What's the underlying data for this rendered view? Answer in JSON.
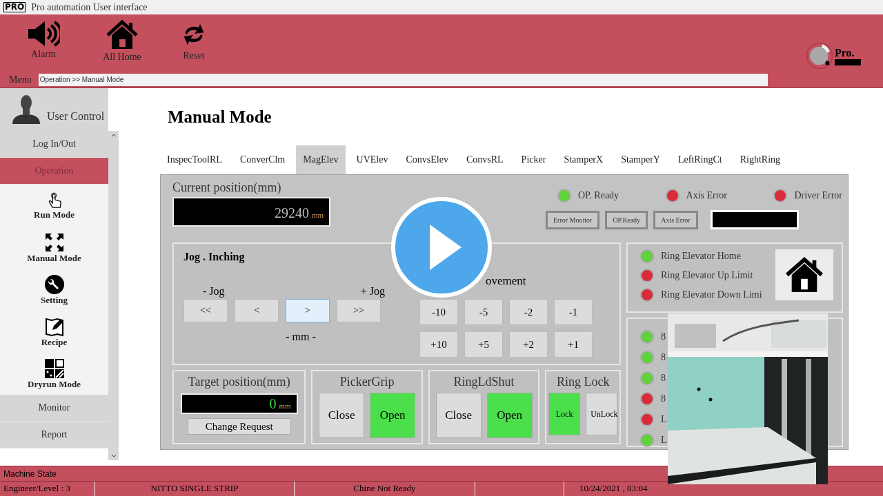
{
  "title_bar": {
    "logo": "PRO",
    "title": "Pro automation User interface"
  },
  "toolbar": {
    "buttons": [
      {
        "label": "Alarm",
        "kind": "alarm"
      },
      {
        "label": "All Home",
        "kind": "home"
      },
      {
        "label": "Reset",
        "kind": "reset"
      }
    ],
    "menu_label": "Menu",
    "breadcrumb": "Operation >> Manual Mode",
    "brand": "Pro."
  },
  "sidebar": {
    "title": "User Control",
    "items": [
      {
        "label": "Log In/Out",
        "kind": "plain",
        "selected": false
      },
      {
        "label": "Operation",
        "kind": "plain",
        "selected": true
      },
      {
        "label": "Run Mode",
        "kind": "run",
        "selected": false
      },
      {
        "label": "Manual Mode",
        "kind": "manual",
        "selected": false
      },
      {
        "label": "Setting",
        "kind": "setting",
        "selected": false
      },
      {
        "label": "Recipe",
        "kind": "recipe",
        "selected": false
      },
      {
        "label": "Dryrun Mode",
        "kind": "dryrun",
        "selected": false
      },
      {
        "label": "Monitor",
        "kind": "plain",
        "selected": false
      },
      {
        "label": "Report",
        "kind": "plain",
        "selected": false
      }
    ]
  },
  "page_title": "Manual Mode",
  "tabs": [
    {
      "label": "InspecToolRL",
      "selected": false
    },
    {
      "label": "ConverClm",
      "selected": false
    },
    {
      "label": "MagElev",
      "selected": true
    },
    {
      "label": "UVElev",
      "selected": false
    },
    {
      "label": "ConvsElev",
      "selected": false
    },
    {
      "label": "ConvsRL",
      "selected": false
    },
    {
      "label": "Picker",
      "selected": false
    },
    {
      "label": "StamperX",
      "selected": false
    },
    {
      "label": "StamperY",
      "selected": false
    },
    {
      "label": "LeftRingCt",
      "selected": false
    },
    {
      "label": "RightRing",
      "selected": false
    }
  ],
  "current_position": {
    "label": "Current position(mm)",
    "value": "29240",
    "unit": "mm"
  },
  "status_lamps": [
    {
      "label": "OP. Ready",
      "color": "#5fd33c"
    },
    {
      "label": "Axis Error",
      "color": "#d92b3a"
    },
    {
      "label": "Driver Error",
      "color": "#d92b3a"
    }
  ],
  "status_buttons": [
    "Error Monitor",
    "OP.Ready",
    "Axis Error"
  ],
  "jog": {
    "title": "Jog . Inching",
    "minus_label": "- Jog",
    "plus_label": "+ Jog",
    "unit_label": "- mm -",
    "buttons": [
      {
        "label": "<<",
        "selected": false
      },
      {
        "label": "<",
        "selected": false
      },
      {
        "label": ">",
        "selected": true
      },
      {
        "label": ">>",
        "selected": false
      }
    ],
    "movement_title": "ovement",
    "movement_buttons": [
      "-10",
      "-5",
      "-2",
      "-1",
      "+10",
      "+5",
      "+2",
      "+1"
    ]
  },
  "target_position": {
    "label": "Target position(mm)",
    "value": "0",
    "unit": "mm",
    "button": "Change Request"
  },
  "toggles": [
    {
      "title": "PickerGrip",
      "buttons": [
        {
          "label": "Close",
          "on": false
        },
        {
          "label": "Open",
          "on": true
        }
      ]
    },
    {
      "title": "RingLdShut",
      "buttons": [
        {
          "label": "Close",
          "on": false
        },
        {
          "label": "Open",
          "on": true
        }
      ]
    },
    {
      "title": "Ring Lock",
      "buttons": [
        {
          "label": "Lock",
          "on": true
        },
        {
          "label": "UnLock",
          "on": false
        }
      ]
    }
  ],
  "elevator_lamps": [
    {
      "label": "Ring Elevator Home",
      "color": "#5fd33c"
    },
    {
      "label": "Ring Elevator Up Limit",
      "color": "#d92b3a"
    },
    {
      "label": "Ring Elevator Down Limi",
      "color": "#d92b3a"
    }
  ],
  "io_lamps": [
    {
      "label": "8",
      "color": "#5fd33c"
    },
    {
      "label": "8",
      "color": "#5fd33c"
    },
    {
      "label": "8",
      "color": "#5fd33c"
    },
    {
      "label": "8",
      "color": "#d92b3a"
    },
    {
      "label": "L",
      "color": "#d92b3a"
    },
    {
      "label": "L",
      "color": "#5fd33c"
    }
  ],
  "status_bar": {
    "title": "Machine State",
    "cells": [
      "Engineer/Level : 3",
      "NITTO SINGLE STRIP",
      "Chine Not Ready",
      "",
      "10/24/2021 , 03:04"
    ]
  }
}
